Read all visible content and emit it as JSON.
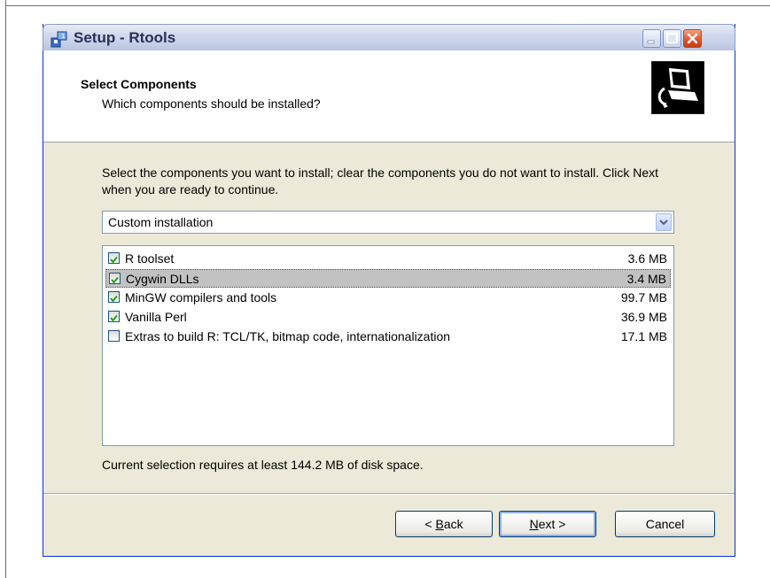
{
  "window": {
    "title": "Setup - Rtools",
    "icons": [
      "setup-app-icon",
      "minimize-icon",
      "maximize-icon",
      "close-icon"
    ]
  },
  "header": {
    "title": "Select Components",
    "subtitle": "Which components should be installed?"
  },
  "body": {
    "description": "Select the components you want to install; clear the components you do not want to install. Click Next when you are ready to continue.",
    "install_type": {
      "selected": "Custom installation"
    },
    "components": [
      {
        "label": "R toolset",
        "size": "3.6 MB",
        "checked": true,
        "selected": false
      },
      {
        "label": "Cygwin DLLs",
        "size": "3.4 MB",
        "checked": true,
        "selected": true
      },
      {
        "label": "MinGW compilers and tools",
        "size": "99.7 MB",
        "checked": true,
        "selected": false
      },
      {
        "label": "Vanilla Perl",
        "size": "36.9 MB",
        "checked": true,
        "selected": false
      },
      {
        "label": "Extras to build R:  TCL/TK, bitmap code, internationalization",
        "size": "17.1 MB",
        "checked": false,
        "selected": false
      }
    ],
    "requirement": "Current selection requires at least 144.2 MB of disk space."
  },
  "buttons": {
    "back": {
      "prefix": "< ",
      "mnemonic": "B",
      "rest": "ack"
    },
    "next": {
      "mnemonic": "N",
      "rest": "ext >"
    },
    "cancel": "Cancel"
  },
  "colors": {
    "dialog_bg": "#ece9d8",
    "selection_bg": "#c2c2c2",
    "check_green": "#21a121",
    "border_blue": "#7f9db9"
  }
}
